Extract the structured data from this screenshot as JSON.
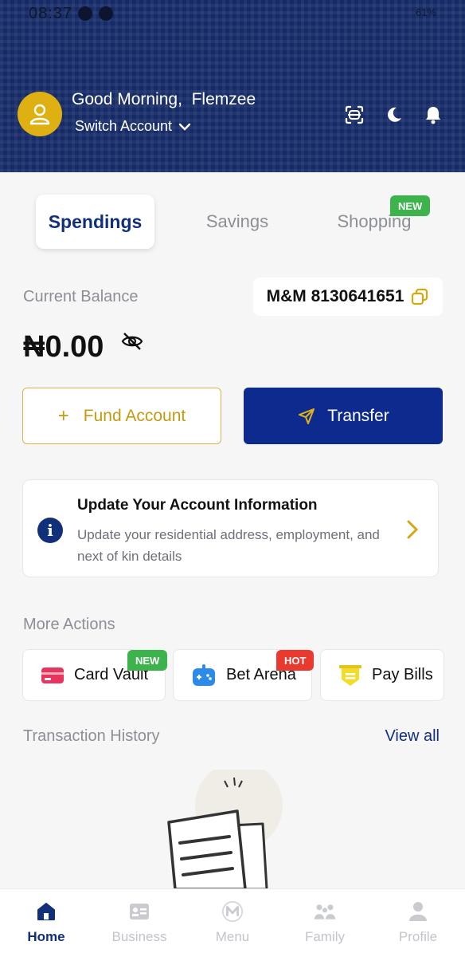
{
  "status_bar": {
    "time": "08:37",
    "battery": "61%"
  },
  "header": {
    "greeting_prefix": "Good Morning,",
    "user_name": "Flemzee",
    "switch_account_label": "Switch Account"
  },
  "tabs": [
    {
      "label": "Spendings",
      "active": true
    },
    {
      "label": "Savings",
      "active": false
    },
    {
      "label": "Shopping",
      "active": false,
      "badge": "NEW"
    }
  ],
  "balance": {
    "label": "Current Balance",
    "account_chip": "M&M 8130641651",
    "amount": "₦0.00"
  },
  "buttons": {
    "fund_plus": "+",
    "fund_label": "Fund Account",
    "transfer_label": "Transfer"
  },
  "info_card": {
    "title": "Update Your Account Information",
    "description": "Update your residential address, employment, and next of kin details"
  },
  "more_actions": {
    "title": "More Actions",
    "items": [
      {
        "label": "Card Vault",
        "badge": "NEW"
      },
      {
        "label": "Bet Arena",
        "badge": "HOT"
      },
      {
        "label": "Pay Bills"
      }
    ]
  },
  "transactions": {
    "title": "Transaction History",
    "view_all": "View all"
  },
  "bottom_nav": [
    {
      "label": "Home",
      "icon": "home-icon",
      "active": true
    },
    {
      "label": "Business",
      "icon": "business-card-icon",
      "active": false
    },
    {
      "label": "Menu",
      "icon": "menu-logo-icon",
      "active": false
    },
    {
      "label": "Family",
      "icon": "family-icon",
      "active": false
    },
    {
      "label": "Profile",
      "icon": "profile-icon",
      "active": false
    }
  ],
  "colors": {
    "brand_navy": "#12307a",
    "accent_gold": "#dfb012",
    "badge_new": "#3cb44b",
    "badge_hot": "#ea3a2f"
  }
}
